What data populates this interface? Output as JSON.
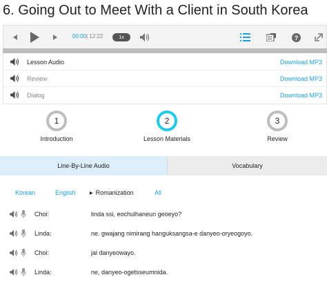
{
  "page": {
    "title": "6. Going Out to Meet With a Client in South Korea"
  },
  "player": {
    "current_time": "00:00",
    "separator": "|",
    "total_time": "12:22",
    "speed": "1x",
    "progress": 0,
    "icons": [
      "rewind-icon",
      "play-icon",
      "forward-icon",
      "volume-icon",
      "list-icon",
      "pdf-icon",
      "help-icon",
      "expand-icon"
    ]
  },
  "tracks": [
    {
      "label": "Lesson Audio",
      "download": "Download MP3",
      "active": true
    },
    {
      "label": "Review",
      "download": "Download MP3",
      "active": false
    },
    {
      "label": "Dialog",
      "download": "Download MP3",
      "active": false
    }
  ],
  "steps": [
    {
      "number": "1",
      "label": "Introduction",
      "active": false
    },
    {
      "number": "2",
      "label": "Lesson Materials",
      "active": true
    },
    {
      "number": "3",
      "label": "Review",
      "active": false
    }
  ],
  "tabs": [
    {
      "label": "Line-By-Line Audio",
      "active": true
    },
    {
      "label": "Vocabulary",
      "active": false
    }
  ],
  "languages": [
    {
      "label": "Korean",
      "selected": false
    },
    {
      "label": "English",
      "selected": false
    },
    {
      "label": "Romanization",
      "selected": true
    },
    {
      "label": "All",
      "selected": false
    }
  ],
  "dialog": [
    {
      "speaker": "Choi:",
      "text": "linda ssi, eochulhaneun geoeyo?"
    },
    {
      "speaker": "Linda:",
      "text": "ne. gwajang nimirang hanguksangsa-e danyeo-oryeogoyo."
    },
    {
      "speaker": "Choi:",
      "text": "jal danyeowayo."
    },
    {
      "speaker": "Linda:",
      "text": "ne, danyeo-ogetsseumnida."
    }
  ],
  "colors": {
    "accent": "#1a9fd6",
    "step_active": "#22c9e8",
    "step_inactive": "#bdbdbd",
    "tab_active": "#dbeef9"
  }
}
